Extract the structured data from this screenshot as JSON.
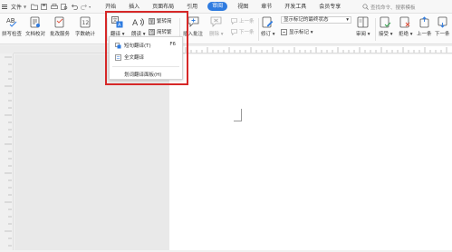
{
  "menubar": {
    "file_label": "文件",
    "tabs": [
      "开始",
      "插入",
      "页面布局",
      "引用",
      "审阅",
      "视图",
      "章节",
      "开发工具",
      "会员专享"
    ],
    "active_tab": "审阅",
    "search_placeholder": "查找命令、搜索模板"
  },
  "ribbon": {
    "spellcheck": "拼写检查",
    "doc_check": "文档校对",
    "batch_service": "批改服务",
    "word_count": "字数统计",
    "translate": "翻译",
    "read_aloud": "朗读",
    "trad_to_simp": "繁转简",
    "simp_to_trad": "简转繁",
    "insert_comment": "插入批注",
    "delete": "删除",
    "prev_comment": "上一条",
    "next_comment": "下一条",
    "track_changes": "修订",
    "display_markup_state": "显示标记的最终状态",
    "show_markup": "显示标记",
    "review": "审阅",
    "accept": "接受",
    "reject": "拒绝",
    "prev": "上一条",
    "next": "下一条"
  },
  "dropdown": {
    "items": [
      {
        "label": "短句翻译(T)",
        "shortcut": "F6"
      },
      {
        "label": "全文翻译"
      },
      {
        "label": "划词翻译面板(H)"
      }
    ]
  },
  "colors": {
    "accent": "#2e7be0",
    "highlight": "#d62828"
  }
}
